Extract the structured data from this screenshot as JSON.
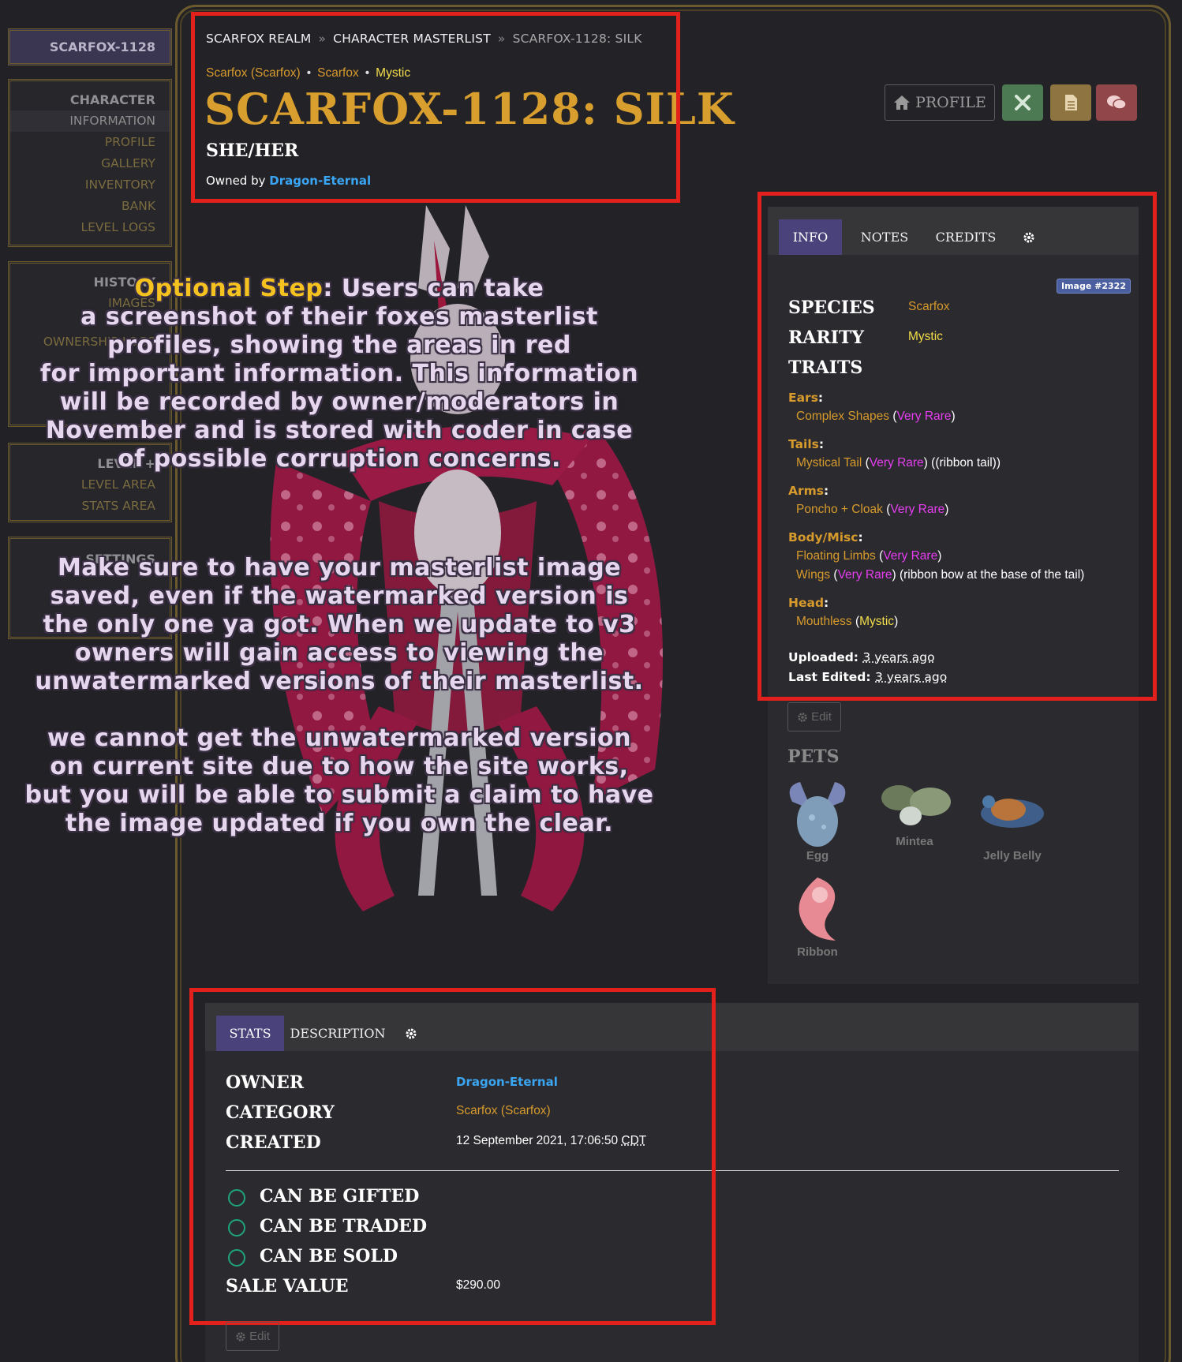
{
  "sidebar": {
    "title": "SCARFOX-1128",
    "character_head": "CHARACTER",
    "character_items": [
      "INFORMATION",
      "PROFILE",
      "GALLERY",
      "INVENTORY",
      "BANK",
      "LEVEL LOGS"
    ],
    "history_head": "HISTORY",
    "history_items": [
      "IMAGES",
      "OWNERSHIP LOGS"
    ],
    "level_head": "LEVEL +",
    "level_items": [
      "LEVEL AREA",
      "STATS AREA"
    ],
    "settings_head": "SETTINGS"
  },
  "breadcrumb": [
    "SCARFOX REALM",
    "CHARACTER MASTERLIST",
    "SCARFOX-1128: SILK"
  ],
  "breadcrumb_sep": "»",
  "meta": {
    "category": "Scarfox (Scarfox)",
    "species": "Scarfox",
    "rarity": "Mystic"
  },
  "character": {
    "title": "SCARFOX-1128: SILK",
    "pronouns": "SHE/HER",
    "owned_by_label": "Owned by",
    "owner": "Dragon-Eternal"
  },
  "header_buttons": {
    "profile": "PROFILE"
  },
  "overlay": {
    "lead_highlight": "Optional Step",
    "p1": [
      ": Users can take",
      "a screenshot of their foxes masterlist",
      "profiles, showing the areas in red",
      "for important information. This information",
      "will be recorded by owner/moderators in",
      "November and is stored with coder in case",
      "of possible corruption concerns."
    ],
    "p2": [
      "Make sure to have your masterlist image",
      "saved, even if the watermarked version is",
      "the only one ya got. When we update to v3",
      "owners will gain access to viewing the",
      "unwatermarked versions of their masterlist."
    ],
    "p3": [
      "we cannot get the unwatermarked version",
      "on current site due to how the site works,",
      "but you will be able to submit a claim to have",
      "the image updated if you own the clear."
    ]
  },
  "info_card": {
    "tabs": [
      "INFO",
      "NOTES",
      "CREDITS"
    ],
    "image_badge": "Image #2322",
    "species_label": "SPECIES",
    "species_value": "Scarfox",
    "rarity_label": "RARITY",
    "rarity_value": "Mystic",
    "traits_label": "TRAITS",
    "traits": [
      {
        "head": "Ears",
        "items": [
          {
            "name": "Complex Shapes",
            "rarity": "Very Rare",
            "note": ""
          }
        ]
      },
      {
        "head": "Tails",
        "items": [
          {
            "name": "Mystical Tail",
            "rarity": "Very Rare",
            "note": "((ribbon tail))"
          }
        ]
      },
      {
        "head": "Arms",
        "items": [
          {
            "name": "Poncho + Cloak",
            "rarity": "Very Rare",
            "note": ""
          }
        ]
      },
      {
        "head": "Body/Misc",
        "items": [
          {
            "name": "Floating Limbs",
            "rarity": "Very Rare",
            "note": ""
          },
          {
            "name": "Wings",
            "rarity": "Very Rare",
            "note": "(ribbon bow at the base of the tail)"
          }
        ]
      },
      {
        "head": "Head",
        "items": [
          {
            "name": "Mouthless",
            "rarity": "Mystic",
            "note": ""
          }
        ]
      }
    ],
    "uploaded_label": "Uploaded:",
    "uploaded_value": "3 years ago",
    "edited_label": "Last Edited:",
    "edited_value": "3 years ago",
    "edit_button": "Edit",
    "pets_label": "PETS",
    "pets": [
      "Egg",
      "Mintea",
      "Jelly Belly",
      "Ribbon"
    ]
  },
  "stats_card": {
    "tabs": [
      "STATS",
      "DESCRIPTION"
    ],
    "owner_label": "OWNER",
    "owner_value": "Dragon-Eternal",
    "category_label": "CATEGORY",
    "category_value": "Scarfox (Scarfox)",
    "created_label": "CREATED",
    "created_value": "12 September 2021, 17:06:50",
    "created_tz": "CDT",
    "flags": [
      "CAN BE GIFTED",
      "CAN BE TRADED",
      "CAN BE SOLD"
    ],
    "sale_label": "SALE VALUE",
    "sale_value": "$290.00",
    "edit_button": "Edit"
  },
  "colors": {
    "accent_purple": "#4a427a",
    "highlight_red": "#e3211c",
    "link_blue": "#3aa5f2",
    "gold": "#d99f2e",
    "very_rare": "#e53df0",
    "mystic": "#f2dc4a"
  },
  "icons": [
    "home-icon",
    "tools-icon",
    "document-icon",
    "comments-icon",
    "gear-icon",
    "edit-gear-icon"
  ]
}
